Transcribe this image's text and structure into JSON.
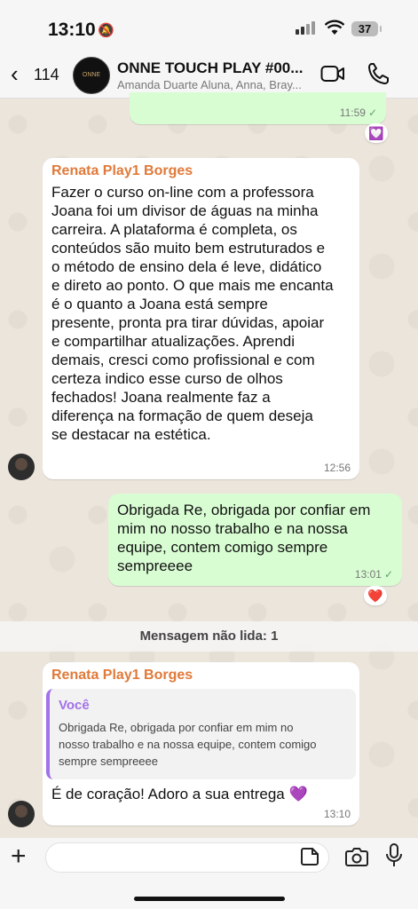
{
  "status_bar": {
    "time": "13:10",
    "battery": "37"
  },
  "header": {
    "back_count": "114",
    "title": "ONNE TOUCH PLAY #00...",
    "subtitle": "Amanda Duarte Aluna, Anna, Bray..."
  },
  "messages": [
    {
      "type": "outgoing",
      "time": "11:59",
      "reaction": "💟"
    },
    {
      "type": "incoming",
      "sender": "Renata Play1 Borges",
      "lines": [
        "Fazer o curso on-line  com a professora",
        "Joana foi um divisor de águas na minha",
        "carreira. A plataforma é completa, os",
        "conteúdos são muito bem estruturados e",
        "o método de ensino dela é leve, didático",
        "e direto ao ponto. O que mais me encanta",
        "é o quanto a Joana está sempre",
        "presente, pronta pra tirar dúvidas, apoiar",
        "e compartilhar atualizações. Aprendi",
        "demais, cresci como profissional e com",
        "certeza indico esse curso de olhos",
        "fechados! Joana realmente faz a",
        "diferença na formação de quem deseja",
        "se destacar na estética."
      ],
      "time": "12:56"
    },
    {
      "type": "outgoing",
      "lines": [
        "Obrigada Re, obrigada por confiar em",
        "mim no nosso trabalho e na nossa",
        "equipe, contem comigo sempre",
        "sempreeee"
      ],
      "time": "13:01",
      "reaction": "❤️"
    },
    {
      "type": "incoming",
      "sender": "Renata Play1 Borges",
      "quote": {
        "name": "Você",
        "lines": [
          "Obrigada Re, obrigada por confiar em mim no",
          "nosso trabalho e na nossa equipe, contem comigo",
          "sempre sempreeee"
        ]
      },
      "text": "É de coração! Adoro a sua entrega 💜",
      "time": "13:10"
    }
  ],
  "unread_label": "Mensagem não lida: 1",
  "colors": {
    "outgoing_bubble": "#d9fdd3",
    "sender_name": "#e07a3a",
    "quote_accent": "#a272e8"
  }
}
